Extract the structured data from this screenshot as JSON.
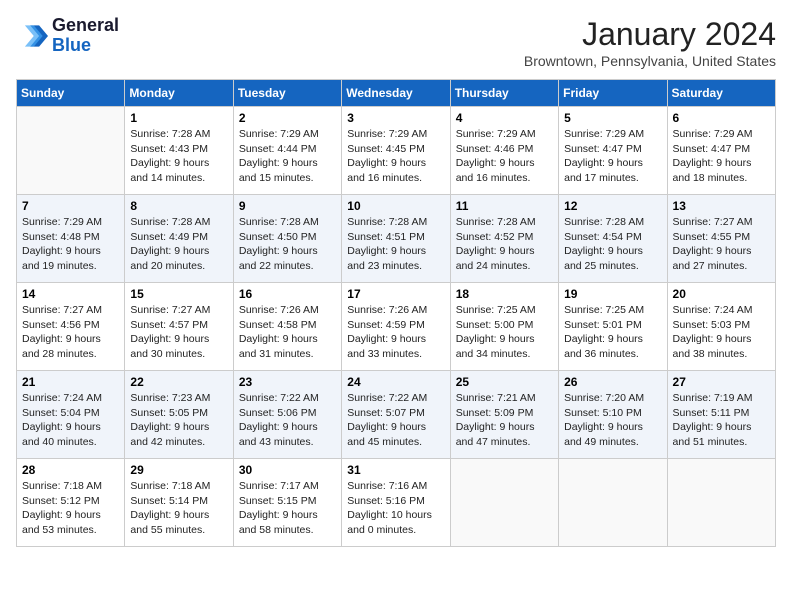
{
  "header": {
    "logo_line1": "General",
    "logo_line2": "Blue",
    "month": "January 2024",
    "location": "Browntown, Pennsylvania, United States"
  },
  "weekdays": [
    "Sunday",
    "Monday",
    "Tuesday",
    "Wednesday",
    "Thursday",
    "Friday",
    "Saturday"
  ],
  "weeks": [
    [
      {
        "day": "",
        "info": ""
      },
      {
        "day": "1",
        "info": "Sunrise: 7:28 AM\nSunset: 4:43 PM\nDaylight: 9 hours\nand 14 minutes."
      },
      {
        "day": "2",
        "info": "Sunrise: 7:29 AM\nSunset: 4:44 PM\nDaylight: 9 hours\nand 15 minutes."
      },
      {
        "day": "3",
        "info": "Sunrise: 7:29 AM\nSunset: 4:45 PM\nDaylight: 9 hours\nand 16 minutes."
      },
      {
        "day": "4",
        "info": "Sunrise: 7:29 AM\nSunset: 4:46 PM\nDaylight: 9 hours\nand 16 minutes."
      },
      {
        "day": "5",
        "info": "Sunrise: 7:29 AM\nSunset: 4:47 PM\nDaylight: 9 hours\nand 17 minutes."
      },
      {
        "day": "6",
        "info": "Sunrise: 7:29 AM\nSunset: 4:47 PM\nDaylight: 9 hours\nand 18 minutes."
      }
    ],
    [
      {
        "day": "7",
        "info": "Sunrise: 7:29 AM\nSunset: 4:48 PM\nDaylight: 9 hours\nand 19 minutes."
      },
      {
        "day": "8",
        "info": "Sunrise: 7:28 AM\nSunset: 4:49 PM\nDaylight: 9 hours\nand 20 minutes."
      },
      {
        "day": "9",
        "info": "Sunrise: 7:28 AM\nSunset: 4:50 PM\nDaylight: 9 hours\nand 22 minutes."
      },
      {
        "day": "10",
        "info": "Sunrise: 7:28 AM\nSunset: 4:51 PM\nDaylight: 9 hours\nand 23 minutes."
      },
      {
        "day": "11",
        "info": "Sunrise: 7:28 AM\nSunset: 4:52 PM\nDaylight: 9 hours\nand 24 minutes."
      },
      {
        "day": "12",
        "info": "Sunrise: 7:28 AM\nSunset: 4:54 PM\nDaylight: 9 hours\nand 25 minutes."
      },
      {
        "day": "13",
        "info": "Sunrise: 7:27 AM\nSunset: 4:55 PM\nDaylight: 9 hours\nand 27 minutes."
      }
    ],
    [
      {
        "day": "14",
        "info": "Sunrise: 7:27 AM\nSunset: 4:56 PM\nDaylight: 9 hours\nand 28 minutes."
      },
      {
        "day": "15",
        "info": "Sunrise: 7:27 AM\nSunset: 4:57 PM\nDaylight: 9 hours\nand 30 minutes."
      },
      {
        "day": "16",
        "info": "Sunrise: 7:26 AM\nSunset: 4:58 PM\nDaylight: 9 hours\nand 31 minutes."
      },
      {
        "day": "17",
        "info": "Sunrise: 7:26 AM\nSunset: 4:59 PM\nDaylight: 9 hours\nand 33 minutes."
      },
      {
        "day": "18",
        "info": "Sunrise: 7:25 AM\nSunset: 5:00 PM\nDaylight: 9 hours\nand 34 minutes."
      },
      {
        "day": "19",
        "info": "Sunrise: 7:25 AM\nSunset: 5:01 PM\nDaylight: 9 hours\nand 36 minutes."
      },
      {
        "day": "20",
        "info": "Sunrise: 7:24 AM\nSunset: 5:03 PM\nDaylight: 9 hours\nand 38 minutes."
      }
    ],
    [
      {
        "day": "21",
        "info": "Sunrise: 7:24 AM\nSunset: 5:04 PM\nDaylight: 9 hours\nand 40 minutes."
      },
      {
        "day": "22",
        "info": "Sunrise: 7:23 AM\nSunset: 5:05 PM\nDaylight: 9 hours\nand 42 minutes."
      },
      {
        "day": "23",
        "info": "Sunrise: 7:22 AM\nSunset: 5:06 PM\nDaylight: 9 hours\nand 43 minutes."
      },
      {
        "day": "24",
        "info": "Sunrise: 7:22 AM\nSunset: 5:07 PM\nDaylight: 9 hours\nand 45 minutes."
      },
      {
        "day": "25",
        "info": "Sunrise: 7:21 AM\nSunset: 5:09 PM\nDaylight: 9 hours\nand 47 minutes."
      },
      {
        "day": "26",
        "info": "Sunrise: 7:20 AM\nSunset: 5:10 PM\nDaylight: 9 hours\nand 49 minutes."
      },
      {
        "day": "27",
        "info": "Sunrise: 7:19 AM\nSunset: 5:11 PM\nDaylight: 9 hours\nand 51 minutes."
      }
    ],
    [
      {
        "day": "28",
        "info": "Sunrise: 7:18 AM\nSunset: 5:12 PM\nDaylight: 9 hours\nand 53 minutes."
      },
      {
        "day": "29",
        "info": "Sunrise: 7:18 AM\nSunset: 5:14 PM\nDaylight: 9 hours\nand 55 minutes."
      },
      {
        "day": "30",
        "info": "Sunrise: 7:17 AM\nSunset: 5:15 PM\nDaylight: 9 hours\nand 58 minutes."
      },
      {
        "day": "31",
        "info": "Sunrise: 7:16 AM\nSunset: 5:16 PM\nDaylight: 10 hours\nand 0 minutes."
      },
      {
        "day": "",
        "info": ""
      },
      {
        "day": "",
        "info": ""
      },
      {
        "day": "",
        "info": ""
      }
    ]
  ]
}
